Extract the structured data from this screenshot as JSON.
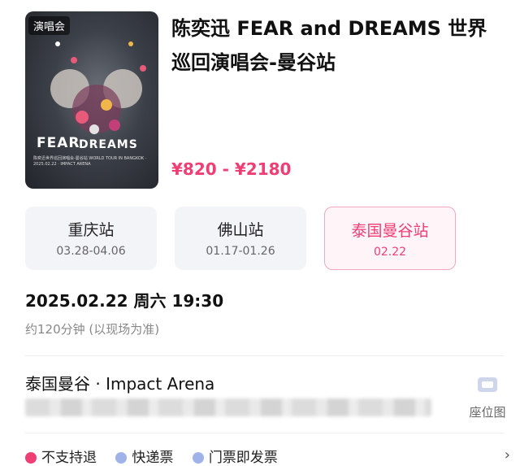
{
  "poster": {
    "badge": "演唱会",
    "title_fear": "FEAR",
    "title_dreams": "DREAMS",
    "subtitle": "陈奕迅世界巡回演唱会-曼谷站 WORLD TOUR IN BANGKOK · 2025.02.22 · IMPACT ARENA"
  },
  "event": {
    "title": "陈奕迅 FEAR and DREAMS 世界巡回演唱会-曼谷站",
    "price_range": "¥820 - ¥2180"
  },
  "stations": [
    {
      "name": "重庆站",
      "dates": "03.28-04.06",
      "selected": false
    },
    {
      "name": "佛山站",
      "dates": "01.17-01.26",
      "selected": false
    },
    {
      "name": "泰国曼谷站",
      "dates": "02.22",
      "selected": true
    }
  ],
  "schedule": {
    "datetime": "2025.02.22 周六 19:30",
    "duration": "约120分钟 (以现场为准)"
  },
  "venue": {
    "name": "泰国曼谷 · Impact Arena",
    "seat_map_label": "座位图"
  },
  "policies": [
    {
      "label": "不支持退",
      "icon": "warning-dot-icon",
      "color": "#ef3e74"
    },
    {
      "label": "快递票",
      "icon": "check-dot-icon",
      "color": "#9fb3e8"
    },
    {
      "label": "门票即发票",
      "icon": "check-dot-icon",
      "color": "#9fb3e8"
    }
  ],
  "colors": {
    "accent": "#ef3e74",
    "selected_border": "#f2a9c0",
    "station_bg": "#f3f4f8"
  }
}
